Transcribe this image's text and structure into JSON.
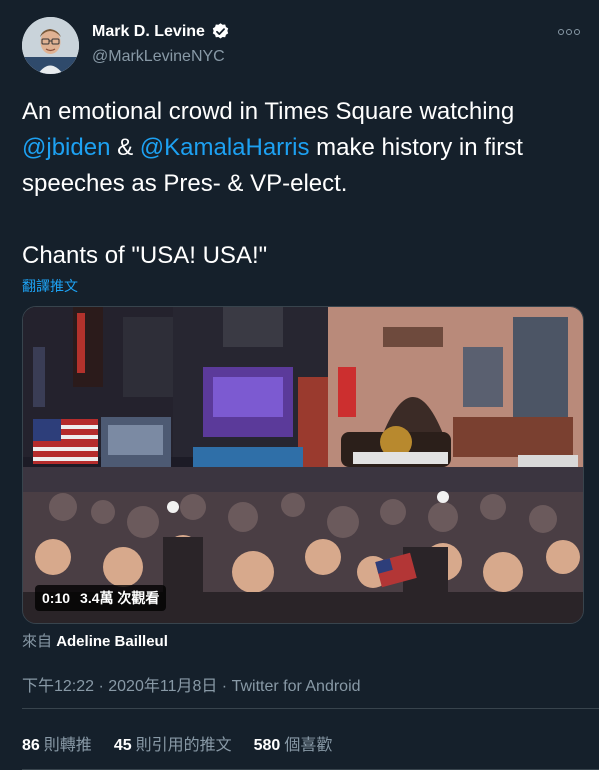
{
  "author": {
    "name": "Mark D. Levine",
    "handle": "@MarkLevineNYC",
    "verified_icon": "verified-badge-icon"
  },
  "text": {
    "line1_start": "An emotional crowd in Times Square watching",
    "mention1": "@jbiden",
    "amp": " & ",
    "mention2": "@KamalaHarris",
    "line2_end": " make history in first speeches as Pres- & VP-elect.",
    "line3": "Chants of \"USA! USA!\""
  },
  "translate_label": "翻譯推文",
  "video": {
    "duration": "0:10",
    "views": "3.4萬 次觀看"
  },
  "source": {
    "prefix": "來自",
    "name": "Adeline Bailleul"
  },
  "meta": {
    "time": "下午12:22 · 2020年11月8日 · Twitter for Android"
  },
  "stats": {
    "retweets_count": "86",
    "retweets_label": "則轉推",
    "quotes_count": "45",
    "quotes_label": "則引用的推文",
    "likes_count": "580",
    "likes_label": "個喜歡"
  },
  "colors": {
    "background": "#15202b",
    "link": "#1da1f2",
    "muted": "#8899a6",
    "border": "#38444d"
  }
}
